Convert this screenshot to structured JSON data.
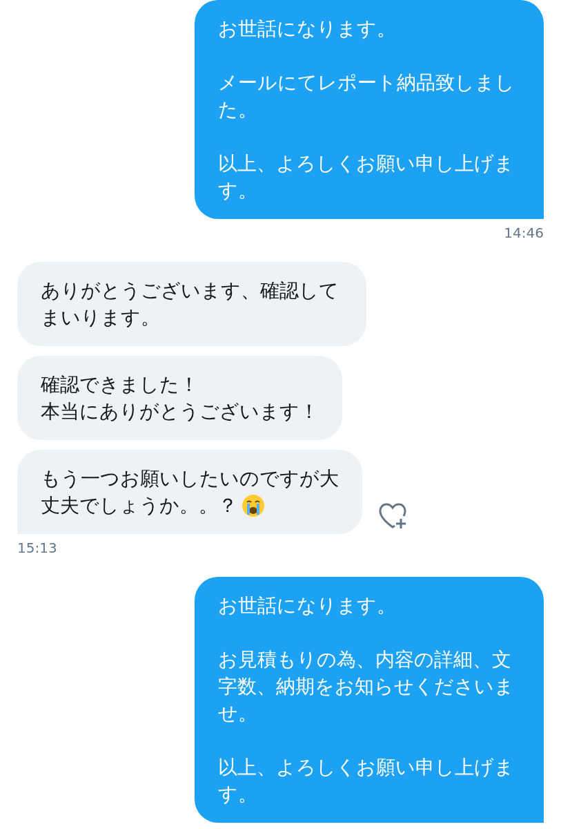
{
  "groups": [
    {
      "kind": "sent",
      "bubbles": [
        {
          "kind": "text",
          "paragraphs": [
            [
              "お世話になります。"
            ],
            [
              "メールにてレポート納品致しました。"
            ],
            [
              "以上、よろしくお願い申し上げます。"
            ]
          ]
        }
      ],
      "time": "14:46"
    },
    {
      "kind": "received",
      "bubbles": [
        {
          "kind": "text",
          "paragraphs": [
            [
              "ありがとうございます、確認してまいります。"
            ]
          ]
        },
        {
          "kind": "text",
          "paragraphs": [
            [
              "確認できました！",
              "本当にありがとうございます！"
            ]
          ]
        },
        {
          "kind": "text_emoji",
          "paragraphs": [
            [
              "もう一つお願いしたいのですが大",
              "丈夫でしょうか。。？"
            ]
          ],
          "react_icon": true
        }
      ],
      "time": "15:13"
    },
    {
      "kind": "sent",
      "bubbles": [
        {
          "kind": "text",
          "paragraphs": [
            [
              "お世話になります。"
            ],
            [
              "お見積もりの為、内容の詳細、文字数、納期をお知らせくださいませ。"
            ],
            [
              "以上、よろしくお願い申し上げます。"
            ]
          ]
        }
      ]
    }
  ]
}
